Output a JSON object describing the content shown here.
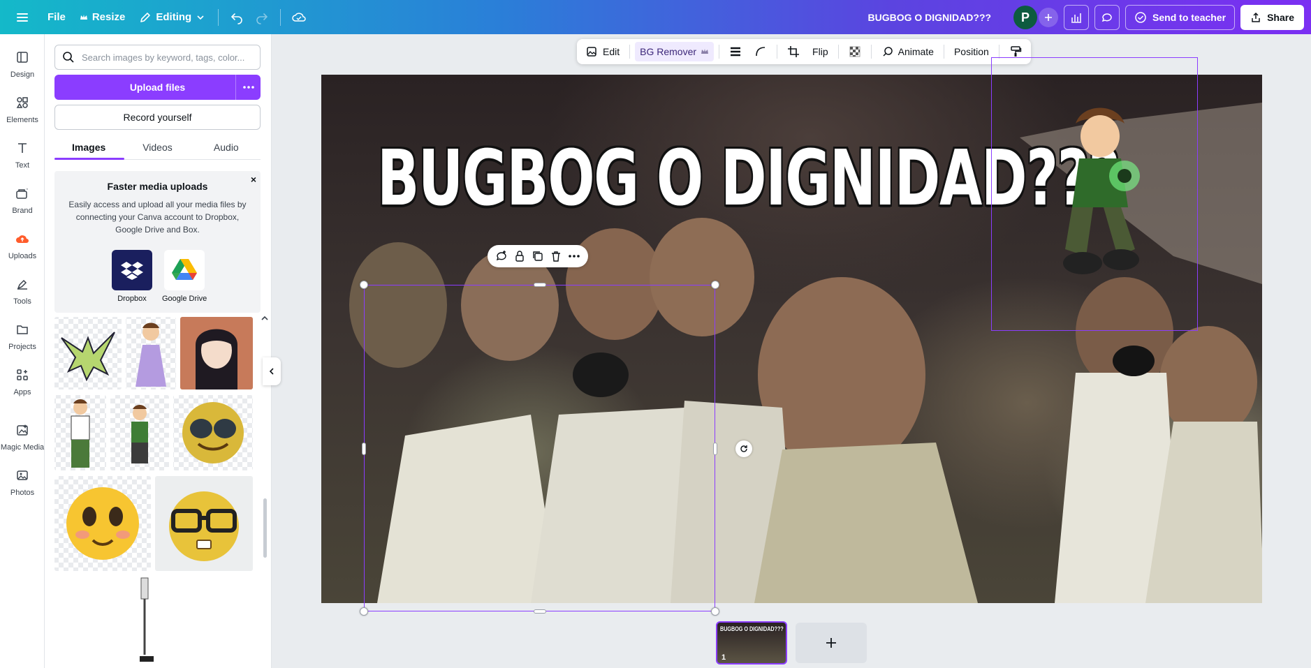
{
  "topbar": {
    "file_label": "File",
    "resize_label": "Resize",
    "editing_label": "Editing",
    "doc_title": "BUGBOG O DIGNIDAD???",
    "avatar_initial": "P",
    "send_label": "Send to teacher",
    "share_label": "Share"
  },
  "rail": {
    "items": [
      {
        "label": "Design",
        "icon": "design-icon"
      },
      {
        "label": "Elements",
        "icon": "elements-icon"
      },
      {
        "label": "Text",
        "icon": "text-icon"
      },
      {
        "label": "Brand",
        "icon": "brand-icon"
      },
      {
        "label": "Uploads",
        "icon": "uploads-icon"
      },
      {
        "label": "Tools",
        "icon": "tools-icon"
      },
      {
        "label": "Projects",
        "icon": "folder-icon"
      },
      {
        "label": "Apps",
        "icon": "apps-icon"
      },
      {
        "label": "Magic Media",
        "icon": "magic-media-icon"
      },
      {
        "label": "Photos",
        "icon": "photos-icon"
      }
    ]
  },
  "panel": {
    "search_placeholder": "Search images by keyword, tags, color...",
    "upload_label": "Upload files",
    "record_label": "Record yourself",
    "tabs": [
      {
        "label": "Images"
      },
      {
        "label": "Videos"
      },
      {
        "label": "Audio"
      }
    ],
    "promo": {
      "close": "×",
      "title": "Faster media uploads",
      "body": "Easily access and upload all your media files by connecting your Canva account to Dropbox, Google Drive and Box.",
      "dropbox": "Dropbox",
      "gdrive": "Google Drive"
    }
  },
  "toolbar": {
    "edit": "Edit",
    "bg_remover": "BG Remover",
    "flip": "Flip",
    "animate": "Animate",
    "position": "Position"
  },
  "canvas": {
    "title_text": "BUGBOG O DIGNIDAD???"
  },
  "pages": {
    "thumb_title": "BUGBOG O DIGNIDAD???",
    "current_number": "1",
    "add": "+"
  },
  "colors": {
    "accent": "#8b3dff",
    "avatar": "#0d5b3f"
  }
}
